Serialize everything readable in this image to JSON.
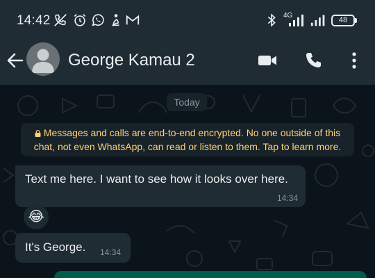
{
  "status_bar": {
    "time": "14:42",
    "network": "4G",
    "battery": "48",
    "icons": [
      "no-call-icon",
      "alarm-icon",
      "whatsapp-icon",
      "notification-icon",
      "gmail-icon",
      "bluetooth-icon",
      "signal-icon",
      "signal-icon",
      "battery-icon"
    ]
  },
  "app_bar": {
    "contact_name": "George Kamau 2",
    "icons": [
      "back-arrow-icon",
      "avatar-icon",
      "video-call-icon",
      "voice-call-icon",
      "more-options-icon"
    ]
  },
  "chat": {
    "date_chip": "Today",
    "encryption_notice": "Messages and calls are end-to-end encrypted. No one outside of this chat, not even WhatsApp, can read or listen to them. Tap to learn more.",
    "messages": [
      {
        "direction": "incoming",
        "text": "Text me here. I want to see how it looks over here.",
        "time": "14:34"
      },
      {
        "direction": "incoming",
        "text": "It's George.",
        "time": "14:34"
      }
    ],
    "reaction_emoji": "😂"
  },
  "colors": {
    "background": "#0b141a",
    "header": "#1f2c34",
    "incoming_bubble": "#202c33",
    "outgoing_bubble": "#005c4b",
    "notice_text": "#ffd279",
    "muted_text": "#8696a0",
    "primary_text": "#e9edef"
  }
}
